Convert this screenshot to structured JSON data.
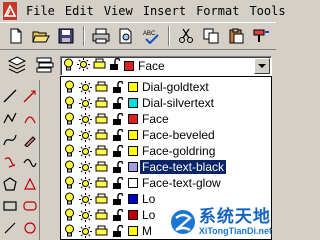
{
  "menu": {
    "items": [
      "File",
      "Edit",
      "View",
      "Insert",
      "Format",
      "Tools"
    ]
  },
  "layer_combo": {
    "value": "Face",
    "color": "#e02020"
  },
  "layers": [
    {
      "name": "Dial-goldtext",
      "color": "#ffff00"
    },
    {
      "name": "Dial-silvertext",
      "color": "#00e0e0"
    },
    {
      "name": "Face",
      "color": "#e02020"
    },
    {
      "name": "Face-beveled",
      "color": "#ffff00"
    },
    {
      "name": "Face-goldring",
      "color": "#ffff00"
    },
    {
      "name": "Face-text-black",
      "color": "#a0a0e0",
      "selected": true
    },
    {
      "name": "Face-text-glow",
      "color": "#ffffff"
    },
    {
      "name": "Lo",
      "color": "#0000c0"
    },
    {
      "name": "Lo",
      "color": "#c00000"
    },
    {
      "name": "M",
      "color": "#ffff00"
    }
  ],
  "watermark": {
    "main": "系统天地",
    "sub": "XiTongTianDi.net"
  }
}
